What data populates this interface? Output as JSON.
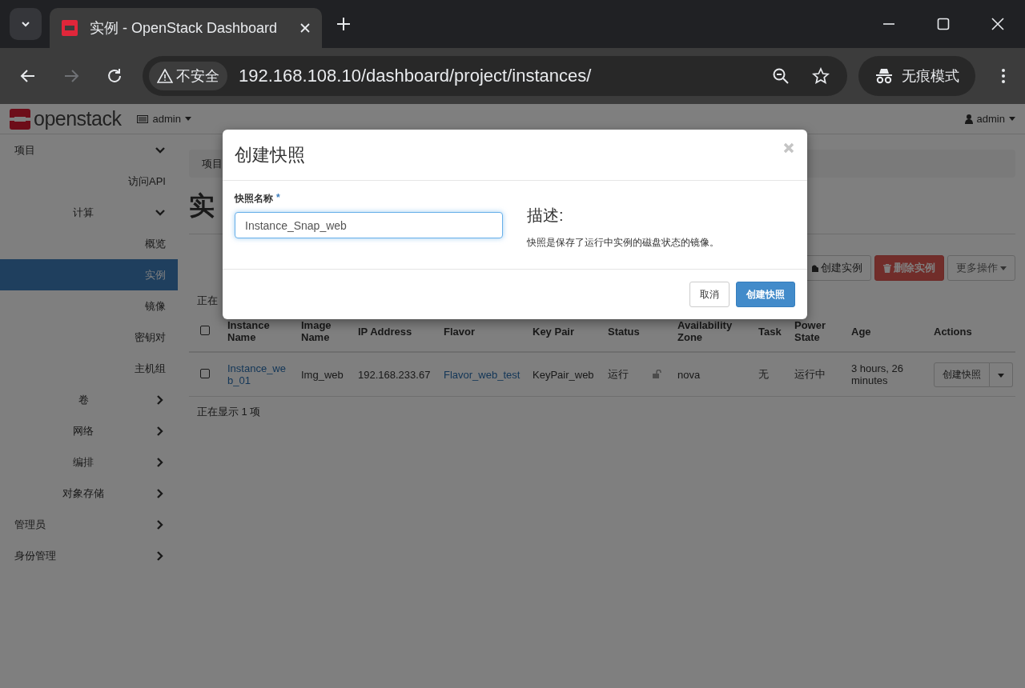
{
  "browser": {
    "tab_title": "实例 - OpenStack Dashboard",
    "security_label": "不安全",
    "url": "192.168.108.10/dashboard/project/instances/",
    "incognito_label": "无痕模式",
    "forward_disabled": true
  },
  "header": {
    "logo_text": "openstack",
    "project": "admin",
    "user": "admin"
  },
  "sidebar": {
    "items": [
      {
        "kind": "group",
        "label": "项目",
        "expanded": true,
        "children": [
          {
            "kind": "item",
            "label": "访问API",
            "selected": false
          },
          {
            "kind": "group",
            "label": "计算",
            "expanded": true,
            "children": [
              {
                "kind": "item",
                "label": "概览",
                "selected": false
              },
              {
                "kind": "item",
                "label": "实例",
                "selected": true
              },
              {
                "kind": "item",
                "label": "镜像",
                "selected": false
              },
              {
                "kind": "item",
                "label": "密钥对",
                "selected": false
              },
              {
                "kind": "item",
                "label": "主机组",
                "selected": false
              }
            ]
          },
          {
            "kind": "group",
            "label": "卷",
            "expanded": false
          },
          {
            "kind": "group",
            "label": "网络",
            "expanded": false
          },
          {
            "kind": "group",
            "label": "编排",
            "expanded": false
          },
          {
            "kind": "group",
            "label": "对象存储",
            "expanded": false
          }
        ]
      },
      {
        "kind": "group",
        "label": "管理员",
        "expanded": false
      },
      {
        "kind": "group",
        "label": "身份管理",
        "expanded": false
      }
    ]
  },
  "breadcrumb": "项目",
  "page_title": "实",
  "toolbar": {
    "buttons": [
      {
        "label": "创建实例",
        "kind": "create"
      },
      {
        "label": "删除实例",
        "kind": "danger"
      },
      {
        "label": "更多操作",
        "kind": "dropdown"
      }
    ]
  },
  "table": {
    "count_top": "正在",
    "select_all_checked": false,
    "columns": [
      "Instance Name",
      "Image Name",
      "IP Address",
      "Flavor",
      "Key Pair",
      "Status",
      "",
      "Availability Zone",
      "Task",
      "Power State",
      "Age",
      "Actions"
    ],
    "rows": [
      {
        "checked": false,
        "cells": [
          {
            "kind": "link",
            "text": "Instance_web_01"
          },
          {
            "kind": "text",
            "text": "Img_web"
          },
          {
            "kind": "text",
            "text": "192.168.233.67"
          },
          {
            "kind": "link",
            "text": "Flavor_web_test"
          },
          {
            "kind": "text",
            "text": "KeyPair_web"
          },
          {
            "kind": "text",
            "text": "运行"
          },
          {
            "kind": "lock",
            "locked": false
          },
          {
            "kind": "text",
            "text": "nova"
          },
          {
            "kind": "text",
            "text": "无"
          },
          {
            "kind": "text",
            "text": "运行中"
          },
          {
            "kind": "text",
            "text": "3 hours, 26 minutes"
          },
          {
            "kind": "action",
            "text": "创建快照"
          }
        ]
      }
    ],
    "footer": "正在显示 1 项"
  },
  "modal": {
    "title": "创建快照",
    "field_label": "快照名称",
    "required_mark": "*",
    "field_value": "Instance_Snap_web",
    "description_title": "描述:",
    "description": "快照是保存了运行中实例的磁盘状态的镜像。",
    "cancel": "取消",
    "submit": "创建快照"
  }
}
